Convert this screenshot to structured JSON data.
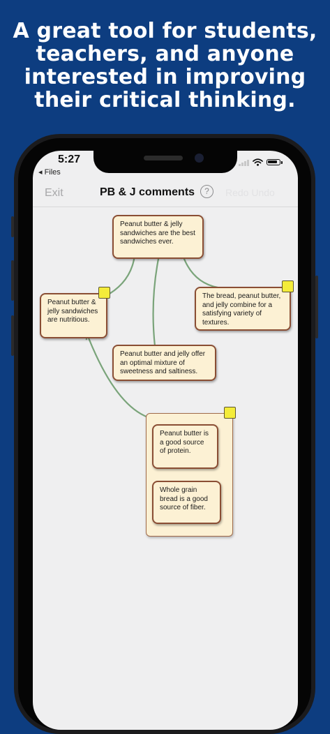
{
  "headline": [
    "A great tool for students,",
    "teachers, and anyone",
    "interested in improving",
    "their critical thinking."
  ],
  "status": {
    "time": "5:27",
    "back_label": "◂ Files"
  },
  "nav": {
    "exit": "Exit",
    "title": "PB & J comments",
    "help": "?",
    "faded": "Redo  Undo"
  },
  "cards": {
    "claim": "Peanut butter & jelly sandwiches are the best sandwiches ever.",
    "nutritious": "Peanut butter & jelly sandwiches are nutritious.",
    "variety": "The bread, peanut butter, and jelly combine for a satisfying variety of textures.",
    "mixture": "Peanut butter and jelly offer an optimal mixture of sweetness and saltiness.",
    "protein": "Peanut butter is a good source of protein.",
    "fiber": "Whole grain bread is a good source of fiber."
  },
  "colors": {
    "background": "#0d3d80",
    "card": "#fcf1d4",
    "card_border": "#8a4e34",
    "arrow": "#7aa47a",
    "sticky": "#f4ec3a"
  },
  "icons": {
    "help": "question-circle-icon",
    "wifi": "wifi-icon",
    "battery": "battery-icon",
    "signal": "cellular-signal-icon",
    "note": "sticky-note-icon"
  }
}
